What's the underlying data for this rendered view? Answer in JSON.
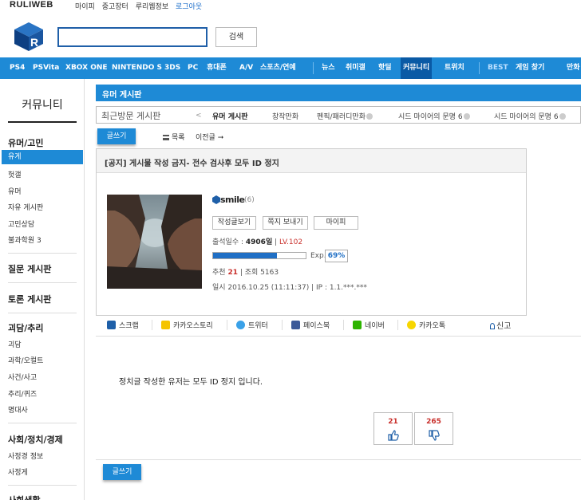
{
  "top": {
    "logo": "RULIWEB",
    "links": [
      "마이피",
      "중고장터",
      "루리웹정보",
      "로그아웃"
    ]
  },
  "search": {
    "value": "",
    "button": "검색"
  },
  "nav": {
    "items": [
      "PS4",
      "PSVita",
      "XBOX ONE",
      "NINTENDO S",
      "3DS",
      "PC",
      "휴대폰",
      "A/V",
      "스포츠/연예",
      "뉴스",
      "취미갤",
      "핫딜",
      "커뮤니티",
      "트위치",
      "BEST",
      "게임 찾기",
      "만화"
    ],
    "active": "커뮤니티"
  },
  "sidebar": {
    "title": "커뮤니티",
    "groups": [
      {
        "heading": "유머/고민",
        "items": [
          "유게",
          "헛갤",
          "유머",
          "자유 게시판",
          "고민상담",
          "불과학원 3"
        ]
      },
      {
        "heading": "질문 게시판",
        "items": []
      },
      {
        "heading": "토론 게시판",
        "items": []
      },
      {
        "heading": "괴담/추리",
        "items": [
          "괴담",
          "과학/오컬트",
          "사건/사고",
          "추리/퀴즈",
          "명대사"
        ]
      },
      {
        "heading": "사회/정치/경제",
        "items": [
          "사정경 정보",
          "사정게"
        ]
      },
      {
        "heading": "사회생활",
        "items": []
      }
    ],
    "active_item": "유게"
  },
  "board": {
    "title": "유머 게시판",
    "recent_label": "최근방문 게시판",
    "recent_prev": "<",
    "recent_items": [
      "유머 게시판",
      "창작만화",
      "펜픽/패러디만화",
      "시드 마이어의 문명 6",
      "시드 마이어의 문명 6"
    ],
    "write_label": "글쓰기",
    "list_label": "목록",
    "prev_label": "이전글 ➞"
  },
  "post": {
    "notice_title": "[공지] 게시물 작성 금지- 전수 검사후 모두 ID 정지",
    "author": {
      "name": "smile",
      "count": "(6)",
      "buttons": [
        "작성글보기",
        "쪽지 보내기",
        "마이피"
      ],
      "attendance_label": "출석일수 :",
      "attendance_value": "4906일",
      "level": "LV.102",
      "exp_label": "Exp.",
      "exp_percent": "69%",
      "exp_fraction": 0.69,
      "recommend_label": "추천",
      "recommend_value": "21",
      "views_label": "| 조회 5163",
      "date_line": "일시 2016.10.25 (11:11:37)  |  IP : 1.1.***.***"
    },
    "share": [
      "스크랩",
      "카카오스토리",
      "트위터",
      "페이스북",
      "네이버",
      "카카오톡"
    ],
    "report": "신고",
    "body": "정치글 작성한 유저는 모두 ID 정지 입니다.",
    "votes": {
      "up": "21",
      "down": "265"
    }
  },
  "colors": {
    "accent": "#1e8ad6",
    "active_nav": "#0a5aa5",
    "alert": "#c9302c"
  }
}
